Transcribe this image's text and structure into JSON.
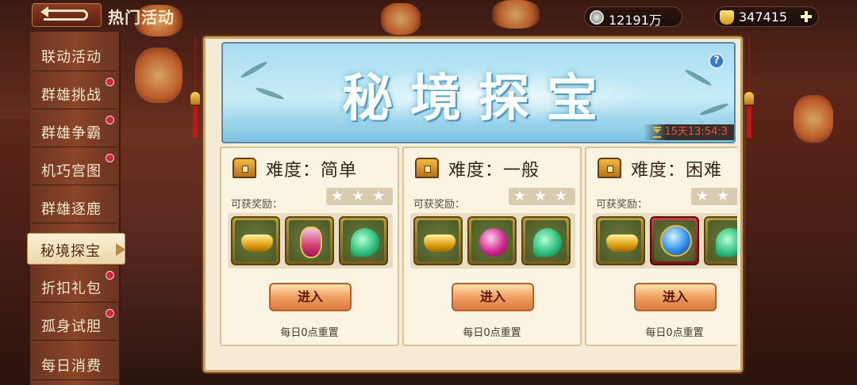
{
  "header": {
    "page_title": "热门活动",
    "currency_silver": "12191万",
    "currency_gold": "347415"
  },
  "icons": {
    "back": "back-arrow-icon",
    "silver": "silver-coin-icon",
    "gold": "gold-ingot-icon",
    "add": "plus-icon",
    "help": "question-icon",
    "timer": "hourglass-icon",
    "chest": "treasure-chest-icon"
  },
  "sidebar": {
    "items": [
      {
        "label": "联动活动",
        "dot": false,
        "active": false
      },
      {
        "label": "群雄挑战",
        "dot": true,
        "active": false
      },
      {
        "label": "群雄争霸",
        "dot": true,
        "active": false
      },
      {
        "label": "机巧宫图",
        "dot": true,
        "active": false
      },
      {
        "label": "群雄逐鹿",
        "dot": false,
        "active": false
      },
      {
        "label": "秘境探宝",
        "dot": false,
        "active": true
      },
      {
        "label": "折扣礼包",
        "dot": true,
        "active": false
      },
      {
        "label": "孤身试胆",
        "dot": true,
        "active": false
      },
      {
        "label": "每日消费",
        "dot": false,
        "active": false
      }
    ]
  },
  "banner": {
    "title": "秘境探宝",
    "help_label": "?",
    "timer": "15天13:54:3"
  },
  "cards": [
    {
      "difficulty": "难度：简单",
      "reward_label": "可获奖励：",
      "stars_filled": 0,
      "stars_total": 3,
      "rewards": [
        "gold-ingot",
        "potion",
        "jade"
      ],
      "enter_label": "进入",
      "reset_label": "每日0点重置"
    },
    {
      "difficulty": "难度：一般",
      "reward_label": "可获奖励：",
      "stars_filled": 0,
      "stars_total": 3,
      "rewards": [
        "gold-ingot",
        "pink-gem",
        "jade"
      ],
      "enter_label": "进入",
      "reset_label": "每日0点重置"
    },
    {
      "difficulty": "难度：困难",
      "reward_label": "可获奖励：",
      "stars_filled": 0,
      "stars_total": 3,
      "rewards": [
        "gold-ingot",
        "crystal-orb",
        "jade"
      ],
      "enter_label": "进入",
      "reset_label": "每日0点重置"
    }
  ],
  "colors": {
    "accent_red": "#d6253a",
    "timer_red": "#ff4a3a",
    "button_orange": "#f0a060",
    "panel_cream": "#f6ecd6"
  }
}
